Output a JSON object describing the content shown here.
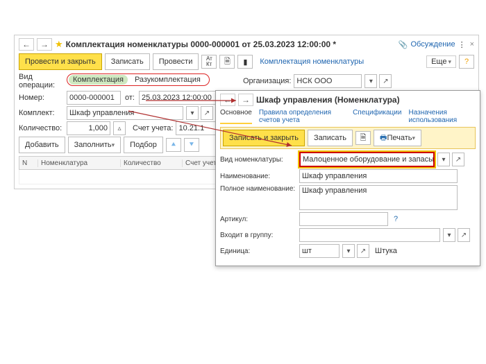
{
  "main": {
    "title": "Комплектация номенклатуры 0000-000001 от 25.03.2023 12:00:00 *",
    "breadcrumb": "Комплектация номенклатуры",
    "discuss": "Обсуждение",
    "more": "Еще",
    "toolbar": {
      "post_close": "Провести и закрыть",
      "write": "Записать",
      "post": "Провести"
    },
    "op_label": "Вид операции:",
    "tab1": "Комплектация",
    "tab2": "Разукомплектация",
    "org_label": "Организация:",
    "org_value": "НСК ООО",
    "num_label": "Номер:",
    "num_value": "0000-000001",
    "ot": "от:",
    "date_value": "25.03.2023 12:00:00",
    "kit_label": "Комплект:",
    "kit_value": "Шкаф управления",
    "qty_label": "Количество:",
    "qty_value": "1,000",
    "acct_label": "Счет учета:",
    "acct_value": "10.21.1",
    "add": "Добавить",
    "fill": "Заполнить",
    "pick": "Подбор",
    "th_n": "N",
    "th_nomen": "Номенклатура",
    "th_qty": "Количество",
    "th_acct": "Счет учета"
  },
  "nested": {
    "title": "Шкаф управления (Номенклатура)",
    "tabs": {
      "main": "Основное",
      "rules": "Правила определения счетов учета",
      "specs": "Спецификации",
      "usages": "Назначения использования"
    },
    "toolbar": {
      "save_close": "Записать и закрыть",
      "write": "Записать",
      "print": "Печать"
    },
    "type_label": "Вид номенклатуры:",
    "type_value": "Малоценное оборудование и запасы",
    "name_label": "Наименование:",
    "name_value": "Шкаф управления",
    "full_label": "Полное наименование:",
    "full_value": "Шкаф управления",
    "artikul_label": "Артикул:",
    "group_label": "Входит в группу:",
    "unit_label": "Единица:",
    "unit_value": "шт",
    "unit_full": "Штука"
  }
}
